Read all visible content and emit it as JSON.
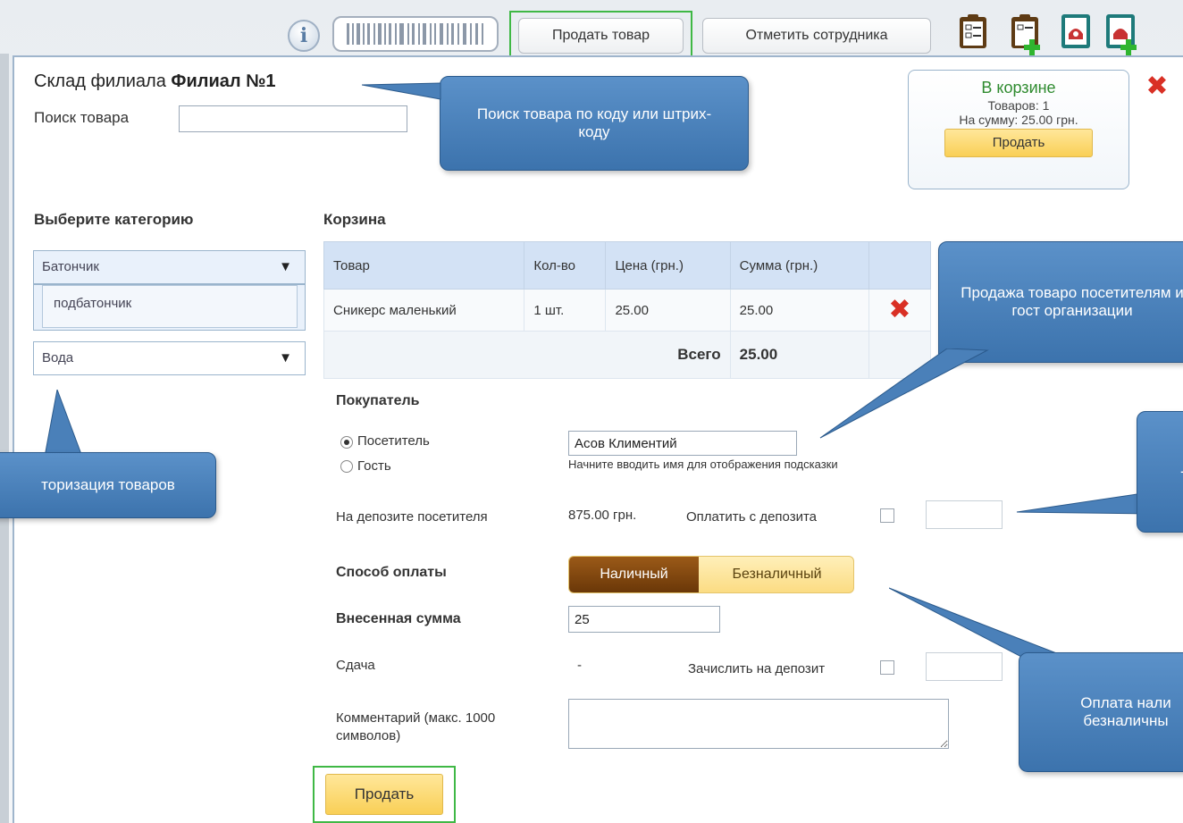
{
  "toolbar": {
    "info_icon": "i",
    "sell_button": "Продать товар",
    "mark_employee_button": "Отметить сотрудника",
    "icons": [
      "clipboard-list-icon",
      "clipboard-add-icon",
      "phone-book-icon",
      "phone-book-add-icon"
    ]
  },
  "warehouse": {
    "title_prefix": "Склад филиала",
    "branch_name": "Филиал №1",
    "search_label": "Поиск товара",
    "search_value": ""
  },
  "cart_summary": {
    "title": "В корзине",
    "items": "Товаров: 1",
    "amount": "На сумму: 25.00 грн.",
    "sell_button": "Продать"
  },
  "categories": {
    "heading": "Выберите категорию",
    "items": [
      {
        "label": "Батончик",
        "arrow": "▼"
      },
      {
        "label": "подбатончик"
      },
      {
        "label": "Вода",
        "arrow": "▼"
      }
    ]
  },
  "cart": {
    "heading": "Корзина",
    "columns": [
      "Товар",
      "Кол-во",
      "Цена (грн.)",
      "Сумма (грн.)"
    ],
    "rows": [
      {
        "product": "Сникерс маленький",
        "qty": "1 шт.",
        "price": "25.00",
        "sum": "25.00"
      }
    ],
    "total_label": "Всего",
    "total_value": "25.00"
  },
  "buyer": {
    "heading": "Покупатель",
    "option_visitor": "Посетитель",
    "option_guest": "Гость",
    "name_value": "Асов Климентий",
    "hint": "Начните вводить имя для отображения подсказки",
    "deposit_label": "На депозите посетителя",
    "deposit_value": "875.00 грн.",
    "pay_from_deposit": "Оплатить с депозита"
  },
  "payment": {
    "method_label": "Способ оплаты",
    "cash": "Наличный",
    "cashless": "Безналичный",
    "paid_label": "Внесенная сумма",
    "paid_value": "25",
    "change_label": "Сдача",
    "change_value": "-",
    "credit_deposit": "Зачислить на депозит",
    "comment_label": "Комментарий (макс. 1000 символов)",
    "submit": "Продать"
  },
  "callouts": {
    "search": "Поиск товара по коду или штрих-коду",
    "categories": "торизация товаров",
    "sale_to": "Продажа товаро посетителям и гост организации",
    "deposit": "-",
    "payment": "Оплата нали безналичны"
  },
  "colors": {
    "green_frame": "#3fb845",
    "callout": "#4a80b9",
    "cash_active": "#7a440e",
    "remove": "#d93025"
  }
}
